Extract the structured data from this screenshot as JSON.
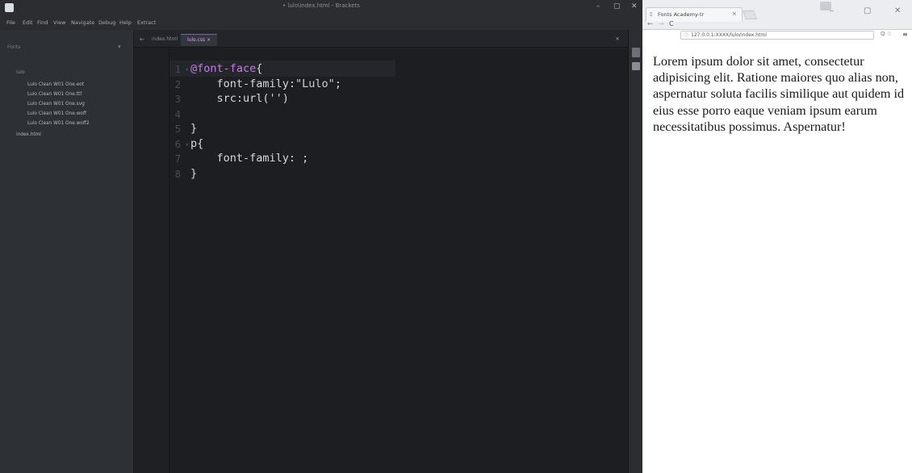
{
  "editor": {
    "window_title": "• lulo\\index.html - Brackets",
    "window_controls": [
      "–",
      "▢",
      "✕"
    ],
    "menu": [
      "File",
      "Edit",
      "Find",
      "View",
      "Navigate",
      "Debug",
      "Help",
      "Extract"
    ],
    "sidebar": {
      "header": "Fonts",
      "items": [
        {
          "label": "lulo",
          "type": "folder"
        },
        {
          "label": "Lulo Clean W01 One.eot",
          "type": "file"
        },
        {
          "label": "Lulo Clean W01 One.ttf",
          "type": "file"
        },
        {
          "label": "Lulo Clean W01 One.svg",
          "type": "file"
        },
        {
          "label": "Lulo Clean W01 One.woff",
          "type": "file"
        },
        {
          "label": "Lulo Clean W01 One.woff2",
          "type": "file"
        },
        {
          "label": "index.html",
          "type": "file"
        }
      ]
    },
    "tabs": {
      "back": "←",
      "index_label": "index.html",
      "active_label": "lulo.css ×",
      "close": "×"
    },
    "code_lines": [
      {
        "n": "1",
        "fold": "▾",
        "segments": [
          {
            "t": "@font-face",
            "c": "kw"
          },
          {
            "t": "{",
            "c": ""
          }
        ]
      },
      {
        "n": "2",
        "fold": "",
        "segments": [
          {
            "t": "    font-family:",
            "c": ""
          },
          {
            "t": "\"Lulo\"",
            "c": "str"
          },
          {
            "t": ";",
            "c": ""
          }
        ]
      },
      {
        "n": "3",
        "fold": "",
        "segments": [
          {
            "t": "    src:url('')",
            "c": ""
          }
        ]
      },
      {
        "n": "4",
        "fold": "",
        "segments": []
      },
      {
        "n": "5",
        "fold": "",
        "segments": [
          {
            "t": "}",
            "c": ""
          }
        ]
      },
      {
        "n": "6",
        "fold": "▾",
        "segments": [
          {
            "t": "p{",
            "c": ""
          }
        ]
      },
      {
        "n": "7",
        "fold": "",
        "segments": [
          {
            "t": "    font-family: ;",
            "c": ""
          }
        ]
      },
      {
        "n": "8",
        "fold": "",
        "segments": [
          {
            "t": "}",
            "c": ""
          }
        ]
      }
    ]
  },
  "browser": {
    "tab_title": "Fonts Academy-tr",
    "tab_close": "×",
    "address": "127.0.0.1:XXXX/lulo/index.html",
    "nav": {
      "back": "←",
      "forward": "→",
      "reload": "C",
      "zoom": "Q ☆",
      "menu": "≡"
    },
    "controls": {
      "minimize": "–",
      "maximize": "▢",
      "close": "✕"
    },
    "page_text": "Lorem ipsum dolor sit amet, consectetur adipisicing elit. Ratione maiores quo alias non, aspernatur soluta facilis similique aut quidem id eius esse porro eaque veniam ipsum earum necessitatibus possimus. Aspernatur!"
  },
  "colors": {
    "editor_bg": "#1c1e22",
    "sidebar_bg": "#2d3034",
    "keyword": "#c879e6",
    "accent_tab": "#7b5ea7"
  }
}
